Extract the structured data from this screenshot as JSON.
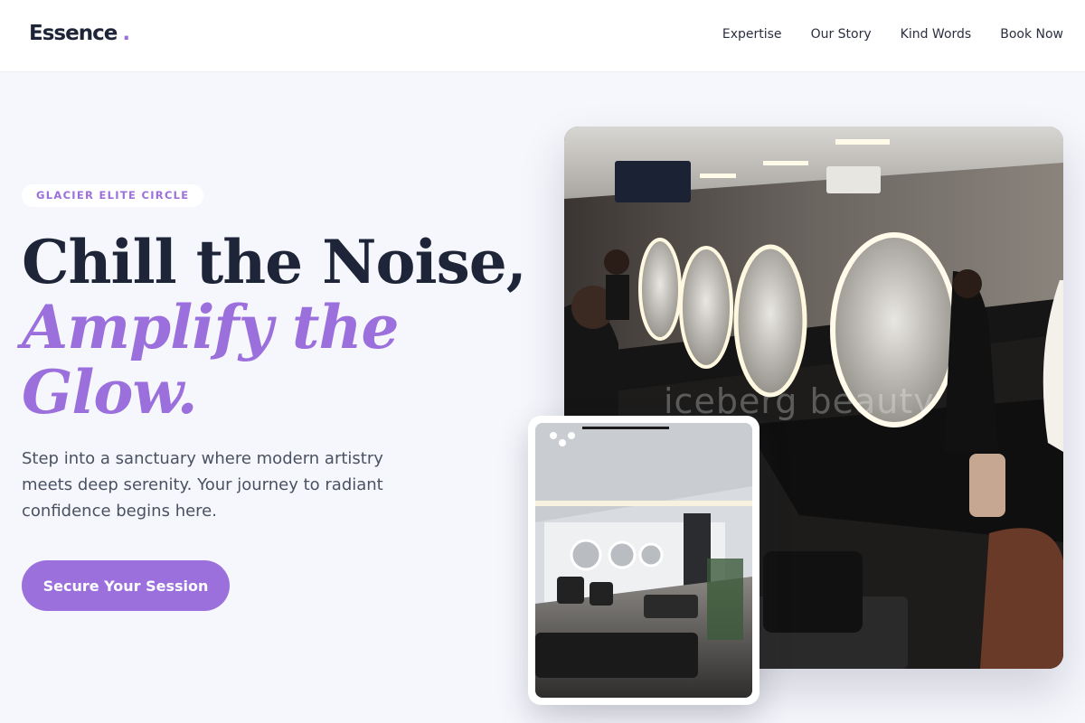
{
  "brand": {
    "name": "Essence",
    "dot": "."
  },
  "nav": {
    "items": [
      {
        "label": "Expertise"
      },
      {
        "label": "Our Story"
      },
      {
        "label": "Kind Words"
      },
      {
        "label": "Book Now"
      }
    ]
  },
  "hero": {
    "badge": "GLACIER ELITE CIRCLE",
    "headline_line1": "Chill the Noise,",
    "headline_accent_line1": "Amplify the",
    "headline_accent_line2": "Glow.",
    "description": "Step into a sanctuary where modern artistry meets deep serenity. Your journey to radiant confidence begins here.",
    "cta_label": "Secure Your Session"
  },
  "images": {
    "main_watermark": "iceberg beauty"
  },
  "colors": {
    "accent": "#9b6fdc",
    "heading": "#1e2538",
    "body_text": "#4a5162",
    "page_bg": "#f6f7fc",
    "nav_bg": "#ffffff"
  }
}
